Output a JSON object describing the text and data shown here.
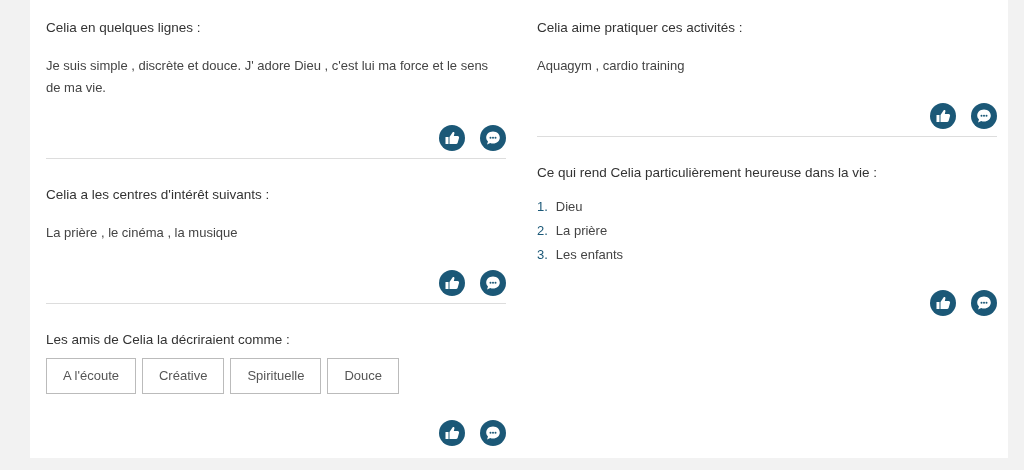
{
  "left_column": [
    {
      "kind": "text",
      "heading": "Celia en quelques lignes :",
      "text": "Je suis simple , discrète et douce. J' adore Dieu , c'est lui ma force et le sens de ma vie."
    },
    {
      "kind": "text",
      "heading": "Celia a les centres d'intérêt suivants :",
      "text": "La prière , le cinéma , la musique"
    },
    {
      "kind": "tags",
      "heading": "Les amis de Celia la décriraient comme :",
      "items": [
        "A l'écoute",
        "Créative",
        "Spirituelle",
        "Douce"
      ]
    }
  ],
  "right_column": [
    {
      "kind": "text",
      "heading": "Celia aime pratiquer ces activités :",
      "text": "Aquagym , cardio training"
    },
    {
      "kind": "list",
      "heading": "Ce qui rend Celia particulièrement heureuse dans la vie :",
      "items": [
        {
          "number": "1.",
          "label": "Dieu"
        },
        {
          "number": "2.",
          "label": "La prière"
        },
        {
          "number": "3.",
          "label": "Les enfants"
        }
      ]
    }
  ]
}
